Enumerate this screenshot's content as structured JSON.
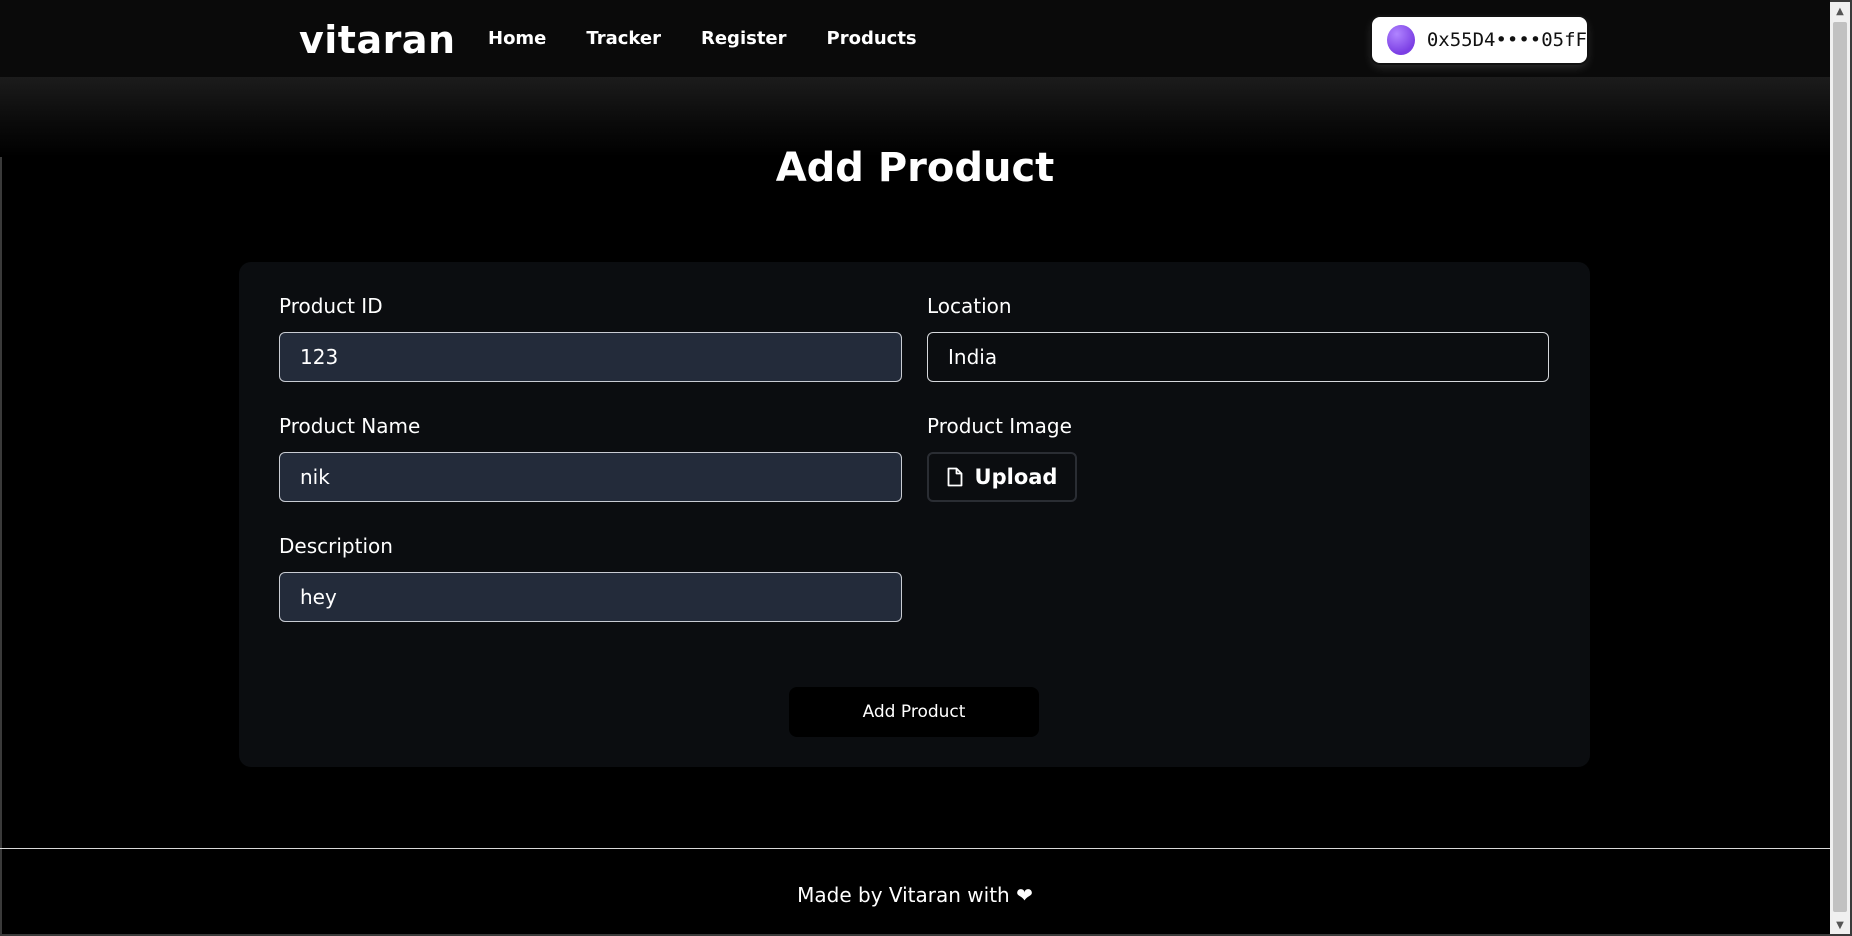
{
  "navbar": {
    "logo": "vitaran",
    "links": [
      "Home",
      "Tracker",
      "Register",
      "Products"
    ],
    "wallet_address": "0x55D4••••05fF"
  },
  "page": {
    "title": "Add Product"
  },
  "form": {
    "product_id": {
      "label": "Product ID",
      "value": "123"
    },
    "location": {
      "label": "Location",
      "value": "India"
    },
    "product_name": {
      "label": "Product Name",
      "value": "nik"
    },
    "product_image": {
      "label": "Product Image",
      "button_label": "Upload"
    },
    "description": {
      "label": "Description",
      "value": "hey"
    },
    "submit_label": "Add Product"
  },
  "footer": {
    "text": "Made by Vitaran with",
    "heart": "❤"
  },
  "icons": {
    "upload": "file-icon",
    "wallet_avatar": "avatar"
  },
  "colors": {
    "background": "#000000",
    "card": "#0b0d10",
    "filled_input": "#232b3a",
    "wallet_avatar": "#7b3fe4"
  }
}
